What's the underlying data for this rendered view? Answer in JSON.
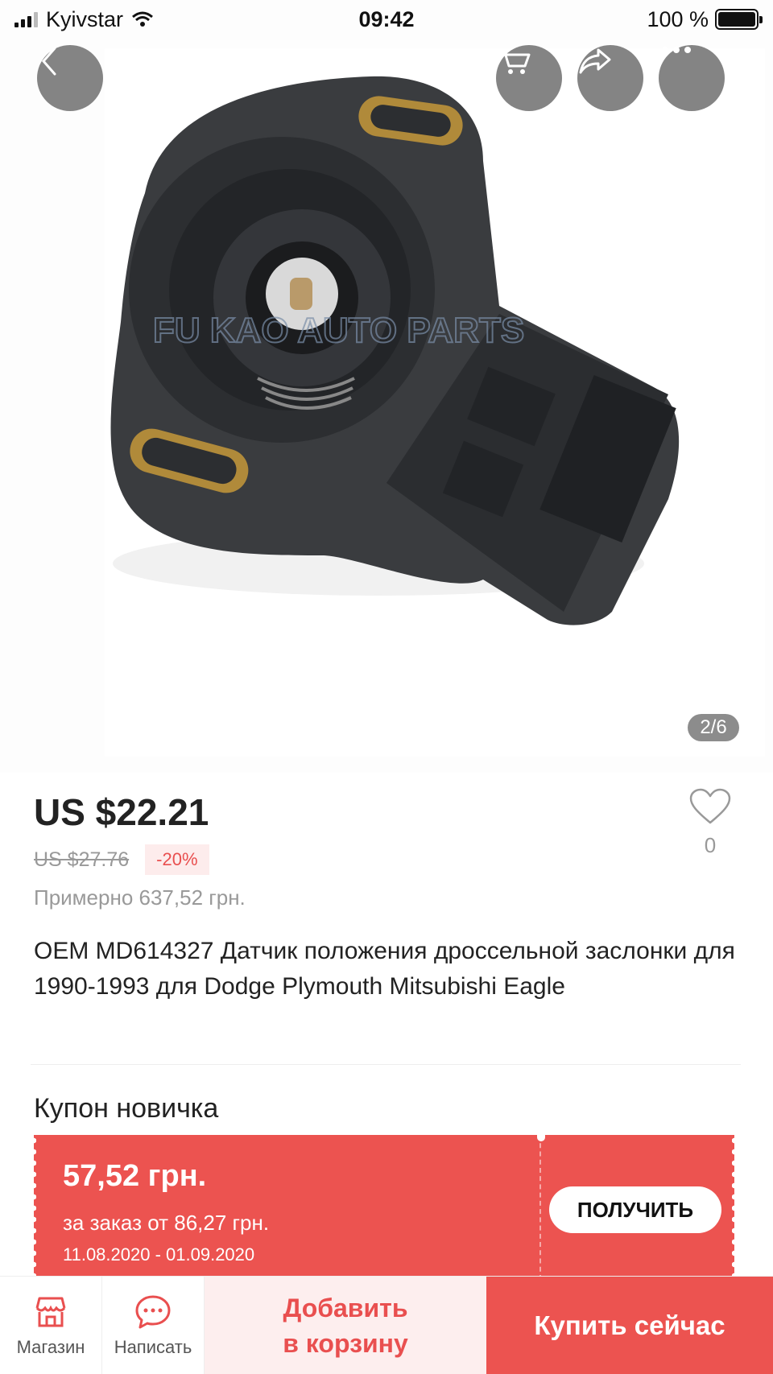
{
  "status_bar": {
    "carrier": "Kyivstar",
    "time": "09:42",
    "battery": "100 %"
  },
  "gallery": {
    "watermark": "FU KAO AUTO PARTS",
    "counter": "2/6",
    "icons": [
      "back-icon",
      "cart-icon",
      "share-icon",
      "more-icon"
    ]
  },
  "product": {
    "price": "US $22.21",
    "old_price": "US $27.76",
    "discount": "-20%",
    "approx": "Примерно 637,52 грн.",
    "wish_count": "0",
    "title": "OEM MD614327 Датчик положения дроссельной заслонки для 1990-1993 для Dodge Plymouth Mitsubishi Eagle"
  },
  "coupon": {
    "heading": "Купон новичка",
    "amount": "57,52 грн.",
    "condition": "за заказ от 86,27 грн.",
    "dates": "11.08.2020 - 01.09.2020",
    "button": "ПОЛУЧИТЬ"
  },
  "bottom_bar": {
    "store": "Магазин",
    "message": "Написать",
    "add_to_cart_line1": "Добавить",
    "add_to_cart_line2": "в корзину",
    "buy_now": "Купить сейчас"
  },
  "colors": {
    "accent": "#ec5350",
    "accent_light": "#fdeeee",
    "muted": "#999999"
  }
}
